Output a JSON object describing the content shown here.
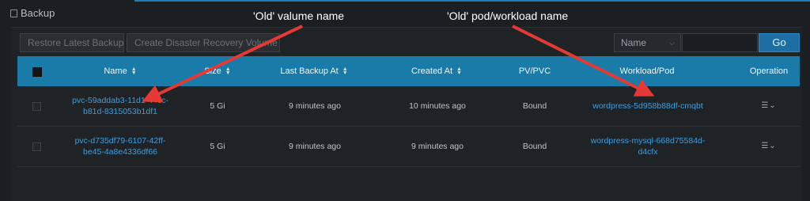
{
  "app": {
    "title": "Backup",
    "accent_color": "#1a7aa8"
  },
  "toolbar": {
    "restore_label": "Restore Latest Backup",
    "disaster_label": "Create Disaster Recovery Volume",
    "filter_select": "Name",
    "search_value": "",
    "go_label": "Go"
  },
  "table": {
    "columns": [
      "Name",
      "Size",
      "Last Backup At",
      "Created At",
      "PV/PVC",
      "Workload/Pod",
      "Operation"
    ],
    "rows": [
      {
        "name_line1": "pvc-59addab3-11d1-44cc-",
        "name_line2": "b81d-8315053b1df1",
        "size": "5 Gi",
        "last_backup": "9 minutes ago",
        "created": "10 minutes ago",
        "pv_pvc": "Bound",
        "workload_line1": "wordpress-5d958b88df-cmqbt",
        "workload_line2": "",
        "operation_icon": "list-icon"
      },
      {
        "name_line1": "pvc-d735df79-6107-42ff-",
        "name_line2": "be45-4a8e4336df66",
        "size": "5 Gi",
        "last_backup": "9 minutes ago",
        "created": "9 minutes ago",
        "pv_pvc": "Bound",
        "workload_line1": "wordpress-mysql-668d75584d-",
        "workload_line2": "d4cfx",
        "operation_icon": "list-icon"
      }
    ]
  },
  "annotations": {
    "volume": "'Old' valume name",
    "pod": "'Old' pod/workload name",
    "color": "#e53935"
  }
}
